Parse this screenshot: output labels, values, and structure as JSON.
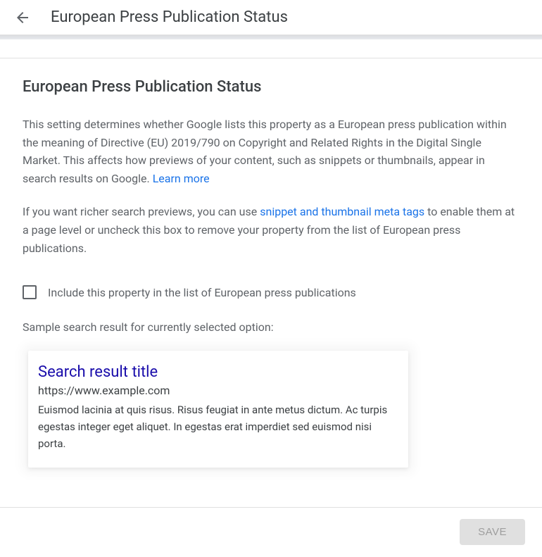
{
  "header": {
    "title": "European Press Publication Status"
  },
  "panel": {
    "title": "European Press Publication Status",
    "description_part1": "This setting determines whether Google lists this property as a European press publication within the meaning of Directive (EU) 2019/790 on Copyright and Related Rights in the Digital Single Market. This affects how previews of your content, such as snippets or thumbnails, appear in search results on Google. ",
    "learn_more": "Learn more",
    "description2_part1": "If you want richer search previews, you can use ",
    "snippet_link": "snippet and thumbnail meta tags",
    "description2_part2": " to enable them at a page level or uncheck this box to remove your property from the list of European press publications.",
    "checkbox_label": "Include this property in the list of European press publications",
    "sample_label": "Sample search result for currently selected option:"
  },
  "sample": {
    "title": "Search result title",
    "url": "https://www.example.com",
    "snippet": "Euismod lacinia at quis risus. Risus feugiat in ante metus dictum. Ac turpis egestas integer eget aliquet. In egestas erat imperdiet sed euismod nisi porta."
  },
  "footer": {
    "save": "SAVE"
  }
}
